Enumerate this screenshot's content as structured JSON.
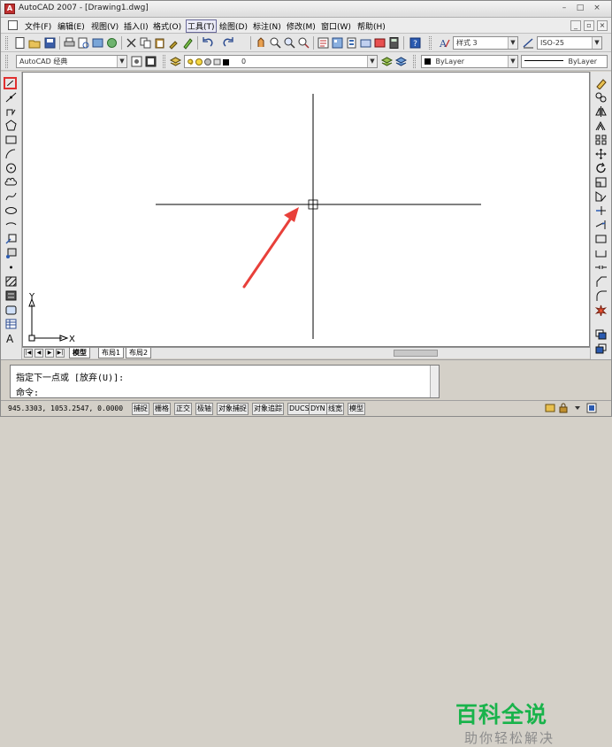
{
  "titlebar": {
    "title": "AutoCAD 2007 - [Drawing1.dwg]",
    "app_icon": "A",
    "minimize_icon": "minimize-icon",
    "maximize_icon": "maximize-icon",
    "close_icon": "close-icon",
    "min_glyph": "–",
    "max_glyph": "□",
    "close_glyph": "×"
  },
  "menubar": {
    "items": [
      {
        "label": "文件(F)"
      },
      {
        "label": "编辑(E)"
      },
      {
        "label": "视图(V)"
      },
      {
        "label": "插入(I)"
      },
      {
        "label": "格式(O)"
      },
      {
        "label": "工具(T)"
      },
      {
        "label": "绘图(D)"
      },
      {
        "label": "标注(N)"
      },
      {
        "label": "修改(M)"
      },
      {
        "label": "窗口(W)"
      },
      {
        "label": "帮助(H)"
      }
    ],
    "doc_min": "_",
    "doc_max": "▫",
    "doc_close": "×"
  },
  "toolbar_standard": {
    "text_style_value": "样式 3",
    "dim_style_value": "ISO-25"
  },
  "toolbar_layers": {
    "workspace_value": "AutoCAD 经典",
    "layer_value": "0",
    "color_value": "ByLayer",
    "linetype_value": "ByLayer"
  },
  "drawing": {
    "ucs_y_label": "Y",
    "ucs_x_label": "X",
    "crosshair_color": "#000000",
    "arrow_color": "#e8403a"
  },
  "layout_tabs": {
    "tabs": [
      {
        "label": "模型"
      },
      {
        "label": "布局1"
      },
      {
        "label": "布局2"
      }
    ]
  },
  "command": {
    "line1": "指定下一点或 [放弃(U)]:",
    "line2": "命令:"
  },
  "statusbar": {
    "coordinates": "945.3303,  1053.2547, 0.0000",
    "toggles": [
      {
        "label": "捕捉"
      },
      {
        "label": "栅格"
      },
      {
        "label": "正交"
      },
      {
        "label": "极轴"
      },
      {
        "label": "对象捕捉"
      },
      {
        "label": "对象追踪"
      },
      {
        "label": "DUCS"
      },
      {
        "label": "DYN"
      },
      {
        "label": "线宽"
      },
      {
        "label": "模型"
      }
    ]
  },
  "watermark": {
    "title": "百科全说",
    "subtitle": "助你轻松解决",
    "title_color": "#19b34b"
  }
}
